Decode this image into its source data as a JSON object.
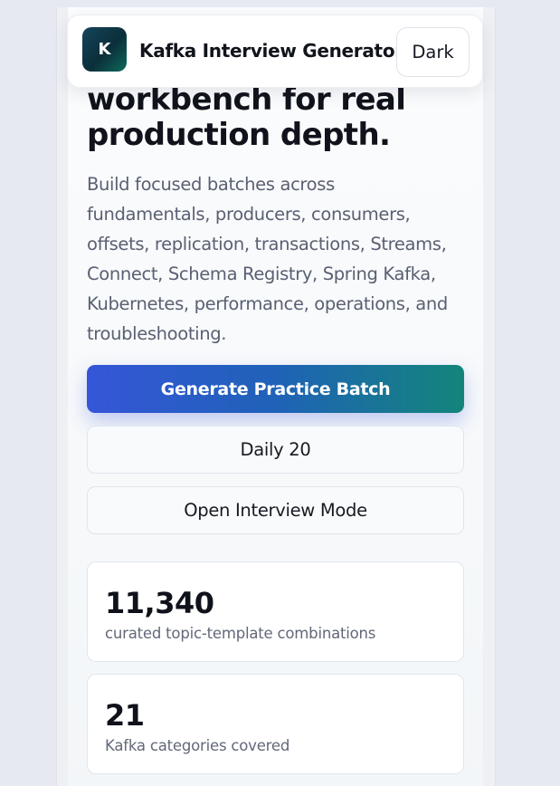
{
  "header": {
    "logo_letter": "K",
    "title": "Kafka Interview Generator",
    "theme_toggle_label": "Dark"
  },
  "hero": {
    "title_line1": "workbench for real",
    "title_line2": "production depth.",
    "description": "Build focused batches across fundamentals, producers, consumers, offsets, replication, transactions, Streams, Connect, Schema Registry, Spring Kafka, Kubernetes, performance, operations, and troubleshooting."
  },
  "actions": {
    "generate_label": "Generate Practice Batch",
    "daily_label": "Daily 20",
    "interview_mode_label": "Open Interview Mode"
  },
  "stats": [
    {
      "value": "11,340",
      "label": "curated topic-template combinations"
    },
    {
      "value": "21",
      "label": "Kafka categories covered"
    }
  ],
  "colors": {
    "page_background": "#e6e8f2",
    "primary_gradient_start": "#3556d8",
    "primary_gradient_end": "#13857a",
    "logo_background": "#0b2f3a"
  }
}
